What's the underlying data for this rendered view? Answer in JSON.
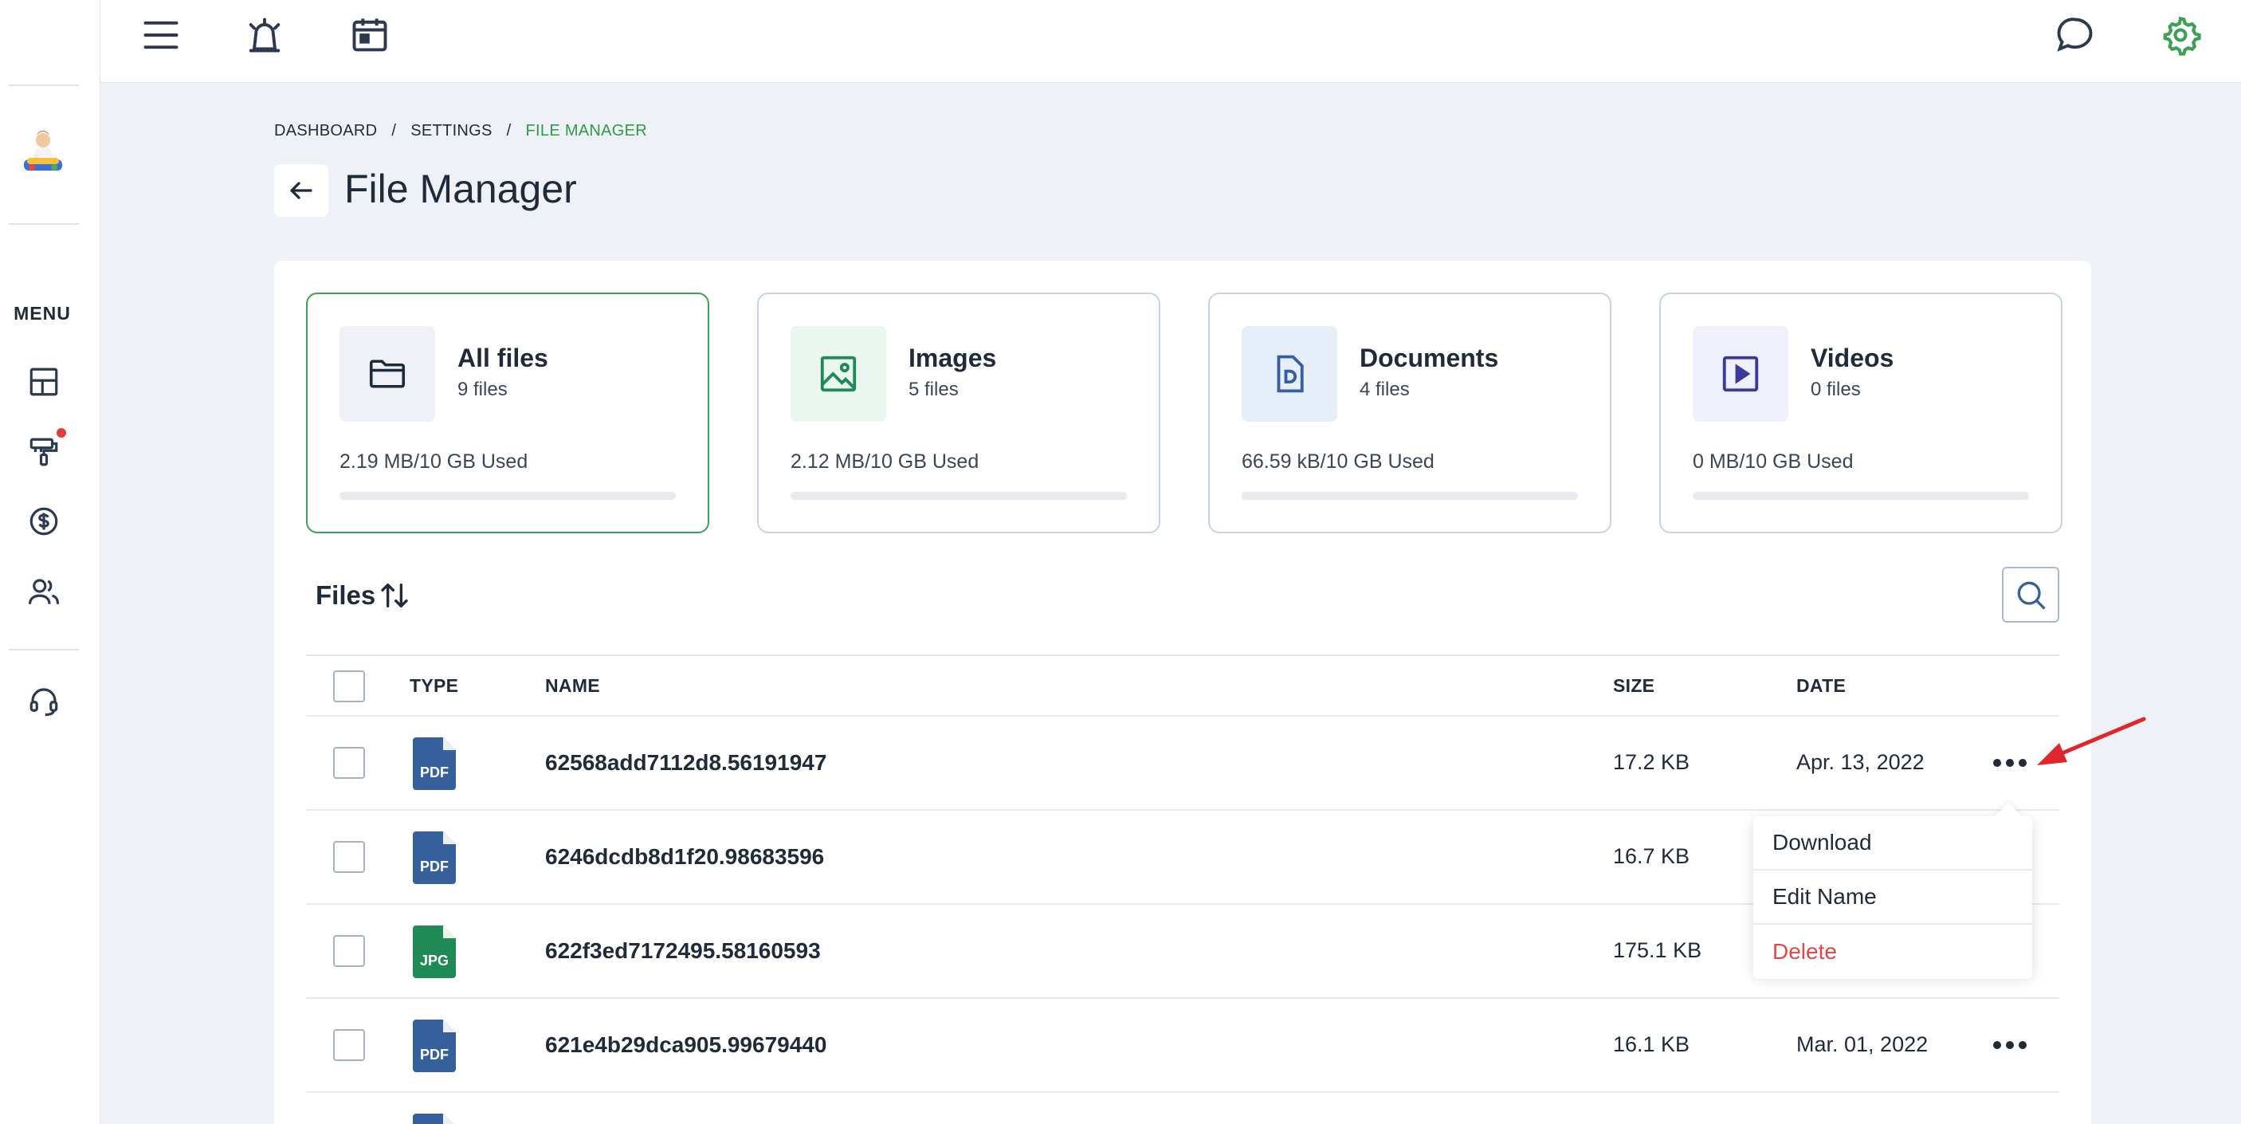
{
  "sidebar": {
    "menu_label": "MENU",
    "items": [
      {
        "icon": "dashboard-grid-icon"
      },
      {
        "icon": "paint-roller-icon",
        "has_notification": true
      },
      {
        "icon": "dollar-icon"
      },
      {
        "icon": "users-icon"
      },
      {
        "icon": "headset-icon"
      }
    ]
  },
  "topbar": {
    "icons": [
      "hamburger-menu-icon",
      "alarm-icon",
      "calendar-icon",
      "chat-icon",
      "gear-icon"
    ]
  },
  "breadcrumb": {
    "items": [
      "DASHBOARD",
      "SETTINGS"
    ],
    "separator": "/",
    "active": "FILE MANAGER"
  },
  "page": {
    "title": "File Manager"
  },
  "cards": [
    {
      "title": "All files",
      "count": "9 files",
      "used": "2.19 MB/10 GB Used",
      "usage_fraction": 0.0,
      "icon": "folder-icon",
      "selected": true
    },
    {
      "title": "Images",
      "count": "5 files",
      "used": "2.12 MB/10 GB Used",
      "usage_fraction": 0.0,
      "icon": "image-icon"
    },
    {
      "title": "Documents",
      "count": "4 files",
      "used": "66.59 kB/10 GB Used",
      "usage_fraction": 0.0,
      "icon": "document-icon"
    },
    {
      "title": "Videos",
      "count": "0 files",
      "used": "0 MB/10 GB Used",
      "usage_fraction": 0.0,
      "icon": "video-icon"
    }
  ],
  "files_section": {
    "title": "Files"
  },
  "table": {
    "headers": {
      "type": "TYPE",
      "name": "NAME",
      "size": "SIZE",
      "date": "DATE"
    },
    "rows": [
      {
        "type": "PDF",
        "name": "62568add7112d8.56191947",
        "size": "17.2 KB",
        "date": "Apr. 13, 2022"
      },
      {
        "type": "PDF",
        "name": "6246dcdb8d1f20.98683596",
        "size": "16.7 KB",
        "date": ""
      },
      {
        "type": "JPG",
        "name": "622f3ed7172495.58160593",
        "size": "175.1 KB",
        "date": ""
      },
      {
        "type": "PDF",
        "name": "621e4b29dca905.99679440",
        "size": "16.1 KB",
        "date": "Mar. 01, 2022"
      }
    ]
  },
  "dropdown": {
    "items": [
      {
        "label": "Download"
      },
      {
        "label": "Edit Name"
      },
      {
        "label": "Delete",
        "danger": true
      }
    ]
  },
  "colors": {
    "accent": "#3ea055",
    "pdf": "#35609b",
    "jpg": "#1f8a55",
    "danger": "#e04848"
  }
}
